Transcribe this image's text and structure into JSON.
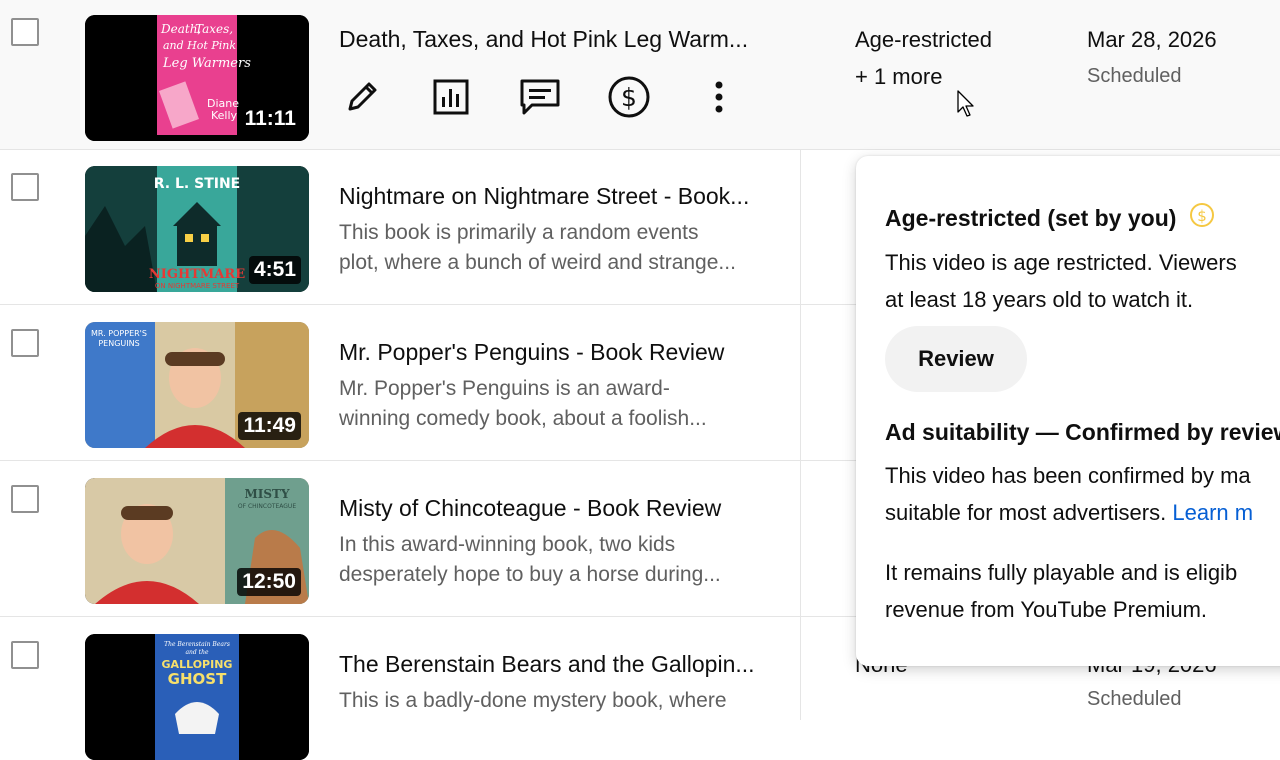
{
  "rows": [
    {
      "title": "Death, Taxes, and Hot Pink Leg Warm...",
      "duration": "11:11",
      "restriction": "Age-restricted",
      "restriction_more": "+ 1 more",
      "date": "Mar 28, 2026",
      "date_status": "Scheduled",
      "thumb_text": [
        "Death,",
        "Taxes,",
        "and Hot Pink",
        "Leg Warmers",
        "Diane",
        "Kelly"
      ]
    },
    {
      "title": "Nightmare on Nightmare Street - Book...",
      "desc_line1": "This book is primarily a random events",
      "desc_line2": "plot, where a bunch of weird and strange...",
      "duration": "4:51",
      "thumb_text": [
        "R. L. STINE",
        "NIGHTMARE",
        "ON NIGHTMARE STREET"
      ]
    },
    {
      "title": "Mr. Popper's Penguins - Book Review",
      "desc_line1": "Mr. Popper's Penguins is an award-",
      "desc_line2": "winning comedy book, about a foolish...",
      "duration": "11:49",
      "thumb_text": [
        "MR. POPPER'S",
        "PENGUINS"
      ]
    },
    {
      "title": "Misty of Chincoteague - Book Review",
      "desc_line1": "In this award-winning book, two kids",
      "desc_line2": "desperately hope to buy a horse during...",
      "duration": "12:50",
      "thumb_text": [
        "MISTY",
        "OF CHINCOTEAGUE"
      ]
    },
    {
      "title": "The Berenstain Bears and the Gallopin...",
      "desc_line1": "This is a badly-done mystery book, where",
      "restriction": "None",
      "date": "Mar 19, 2026",
      "date_status": "Scheduled",
      "thumb_text": [
        "The Berenstain Bears",
        "and the",
        "GALLOPING",
        "GHOST"
      ]
    }
  ],
  "actions": [
    "pencil-icon",
    "analytics-icon",
    "comments-icon",
    "monetization-icon",
    "more-vert-icon"
  ],
  "popup": {
    "age_heading": "Age-restricted (set by you)",
    "age_line1": "This video is age restricted. Viewers",
    "age_line2": "at least 18 years old to watch it.",
    "review_label": "Review",
    "ad_heading": "Ad suitability — Confirmed by review",
    "ad_line1": "This video has been confirmed by ma",
    "ad_line2_text": "suitable for most advertisers.",
    "ad_link": "Learn m",
    "play_line1": "It remains fully playable and is eligib",
    "play_line2": "revenue from YouTube Premium."
  },
  "colors": {
    "coin": "#f5c842",
    "link": "#065fd4",
    "text_secondary": "#606060"
  }
}
